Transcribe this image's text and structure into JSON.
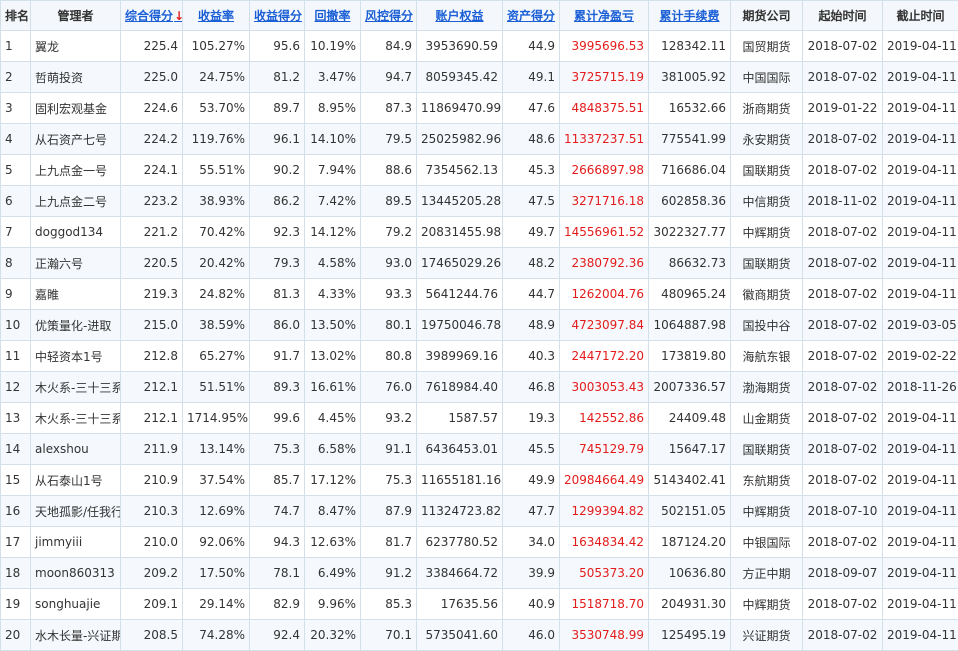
{
  "columns": [
    {
      "label": "排名",
      "sortable": false
    },
    {
      "label": "管理者",
      "sortable": false
    },
    {
      "label": "综合得分",
      "sortable": true,
      "active_sort": true,
      "arrow": "↓"
    },
    {
      "label": "收益率",
      "sortable": true
    },
    {
      "label": "收益得分",
      "sortable": true
    },
    {
      "label": "回撤率",
      "sortable": true
    },
    {
      "label": "风控得分",
      "sortable": true
    },
    {
      "label": "账户权益",
      "sortable": true
    },
    {
      "label": "资产得分",
      "sortable": true
    },
    {
      "label": "累计净盈亏",
      "sortable": true
    },
    {
      "label": "累计手续费",
      "sortable": true
    },
    {
      "label": "期货公司",
      "sortable": false
    },
    {
      "label": "起始时间",
      "sortable": false
    },
    {
      "label": "截止时间",
      "sortable": false
    }
  ],
  "rows": [
    [
      "1",
      "翼龙",
      "225.4",
      "105.27%",
      "95.6",
      "10.19%",
      "84.9",
      "3953690.59",
      "44.9",
      "3995696.53",
      "128342.11",
      "国贸期货",
      "2018-07-02",
      "2019-04-11"
    ],
    [
      "2",
      "哲萌投资",
      "225.0",
      "24.75%",
      "81.2",
      "3.47%",
      "94.7",
      "8059345.42",
      "49.1",
      "3725715.19",
      "381005.92",
      "中国国际",
      "2018-07-02",
      "2019-04-11"
    ],
    [
      "3",
      "固利宏观基金",
      "224.6",
      "53.70%",
      "89.7",
      "8.95%",
      "87.3",
      "11869470.99",
      "47.6",
      "4848375.51",
      "16532.66",
      "浙商期货",
      "2019-01-22",
      "2019-04-11"
    ],
    [
      "4",
      "从石资产七号",
      "224.2",
      "119.76%",
      "96.1",
      "14.10%",
      "79.5",
      "25025982.96",
      "48.6",
      "11337237.51",
      "775541.99",
      "永安期货",
      "2018-07-02",
      "2019-04-11"
    ],
    [
      "5",
      "上九点金一号",
      "224.1",
      "55.51%",
      "90.2",
      "7.94%",
      "88.6",
      "7354562.13",
      "45.3",
      "2666897.98",
      "716686.04",
      "国联期货",
      "2018-07-02",
      "2019-04-11"
    ],
    [
      "6",
      "上九点金二号",
      "223.2",
      "38.93%",
      "86.2",
      "7.42%",
      "89.5",
      "13445205.28",
      "47.5",
      "3271716.18",
      "602858.36",
      "中信期货",
      "2018-11-02",
      "2019-04-11"
    ],
    [
      "7",
      "doggod134",
      "221.2",
      "70.42%",
      "92.3",
      "14.12%",
      "79.2",
      "20831455.98",
      "49.7",
      "14556961.52",
      "3022327.77",
      "中辉期货",
      "2018-07-02",
      "2019-04-11"
    ],
    [
      "8",
      "正瀚六号",
      "220.5",
      "20.42%",
      "79.3",
      "4.58%",
      "93.0",
      "17465029.26",
      "48.2",
      "2380792.36",
      "86632.73",
      "国联期货",
      "2018-07-02",
      "2019-04-11"
    ],
    [
      "9",
      "嘉睢",
      "219.3",
      "24.82%",
      "81.3",
      "4.33%",
      "93.3",
      "5641244.76",
      "44.7",
      "1262004.76",
      "480965.24",
      "徽商期货",
      "2018-07-02",
      "2019-04-11"
    ],
    [
      "10",
      "优策量化-进取",
      "215.0",
      "38.59%",
      "86.0",
      "13.50%",
      "80.1",
      "19750046.78",
      "48.9",
      "4723097.84",
      "1064887.98",
      "国投中谷",
      "2018-07-02",
      "2019-03-05"
    ],
    [
      "11",
      "中轻资本1号",
      "212.8",
      "65.27%",
      "91.7",
      "13.02%",
      "80.8",
      "3989969.16",
      "40.3",
      "2447172.20",
      "173819.80",
      "海航东银",
      "2018-07-02",
      "2019-02-22"
    ],
    [
      "12",
      "木火系-三十三系",
      "212.1",
      "51.51%",
      "89.3",
      "16.61%",
      "76.0",
      "7618984.40",
      "46.8",
      "3003053.43",
      "2007336.57",
      "渤海期货",
      "2018-07-02",
      "2018-11-26"
    ],
    [
      "13",
      "木火系-三十三系",
      "212.1",
      "1714.95%",
      "99.6",
      "4.45%",
      "93.2",
      "1587.57",
      "19.3",
      "142552.86",
      "24409.48",
      "山金期货",
      "2018-07-02",
      "2019-04-11"
    ],
    [
      "14",
      "alexshou",
      "211.9",
      "13.14%",
      "75.3",
      "6.58%",
      "91.1",
      "6436453.01",
      "45.5",
      "745129.79",
      "15647.17",
      "国联期货",
      "2018-07-02",
      "2019-04-11"
    ],
    [
      "15",
      "从石泰山1号",
      "210.9",
      "37.54%",
      "85.7",
      "17.12%",
      "75.3",
      "11655181.16",
      "49.9",
      "20984664.49",
      "5143402.41",
      "东航期货",
      "2018-07-02",
      "2019-04-11"
    ],
    [
      "16",
      "天地孤影/任我行",
      "210.3",
      "12.69%",
      "74.7",
      "8.47%",
      "87.9",
      "11324723.82",
      "47.7",
      "1299394.82",
      "502151.05",
      "中辉期货",
      "2018-07-10",
      "2019-04-11"
    ],
    [
      "17",
      "jimmyiii",
      "210.0",
      "92.06%",
      "94.3",
      "12.63%",
      "81.7",
      "6237780.52",
      "34.0",
      "1634834.42",
      "187124.20",
      "中银国际",
      "2018-07-02",
      "2019-04-11"
    ],
    [
      "18",
      "moon860313",
      "209.2",
      "17.50%",
      "78.1",
      "6.49%",
      "91.2",
      "3384664.72",
      "39.9",
      "505373.20",
      "10636.80",
      "方正中期",
      "2018-09-07",
      "2019-04-11"
    ],
    [
      "19",
      "songhuajie",
      "209.1",
      "29.14%",
      "82.9",
      "9.96%",
      "85.3",
      "17635.56",
      "40.9",
      "1518718.70",
      "204931.30",
      "中辉期货",
      "2018-07-02",
      "2019-04-11"
    ],
    [
      "20",
      "水木长量-兴证期货",
      "208.5",
      "74.28%",
      "92.4",
      "20.32%",
      "70.1",
      "5735041.60",
      "46.0",
      "3530748.99",
      "125495.19",
      "兴证期货",
      "2018-07-02",
      "2019-04-11"
    ]
  ],
  "colors": {
    "link": "#1a5fd6",
    "loss_profit": "#e31b1b",
    "border": "#d3dfe9",
    "header_bg": "#f4f7fb"
  }
}
